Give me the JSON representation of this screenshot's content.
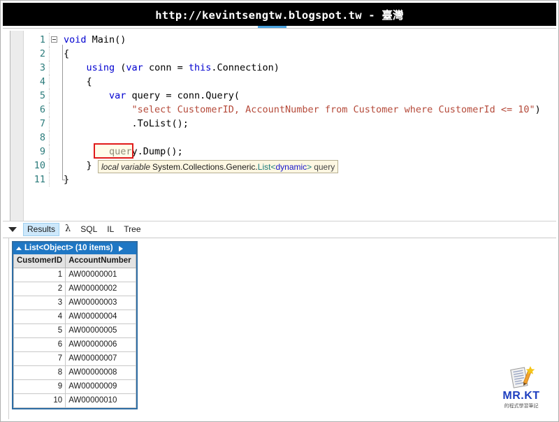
{
  "window": {
    "title_url": "http://kevintsengtw.blogspot.tw",
    "title_sep": " - ",
    "title_region": "臺灣"
  },
  "editor": {
    "lines": [
      {
        "n": "1",
        "indent": 0,
        "tokens": [
          {
            "t": "kw",
            "v": "void"
          },
          {
            "t": "plain",
            "v": " Main()"
          }
        ]
      },
      {
        "n": "2",
        "indent": 0,
        "tokens": [
          {
            "t": "plain",
            "v": "{"
          }
        ]
      },
      {
        "n": "3",
        "indent": 1,
        "tokens": [
          {
            "t": "kw",
            "v": "using"
          },
          {
            "t": "plain",
            "v": " ("
          },
          {
            "t": "kw",
            "v": "var"
          },
          {
            "t": "plain",
            "v": " conn = "
          },
          {
            "t": "kw",
            "v": "this"
          },
          {
            "t": "plain",
            "v": ".Connection)"
          }
        ]
      },
      {
        "n": "4",
        "indent": 1,
        "tokens": [
          {
            "t": "plain",
            "v": "{"
          }
        ]
      },
      {
        "n": "5",
        "indent": 2,
        "tokens": [
          {
            "t": "kw",
            "v": "var"
          },
          {
            "t": "plain",
            "v": " query = conn.Query("
          }
        ]
      },
      {
        "n": "6",
        "indent": 3,
        "tokens": [
          {
            "t": "str",
            "v": "\"select CustomerID, AccountNumber from Customer where CustomerId <= 10\""
          },
          {
            "t": "plain",
            "v": ")"
          }
        ]
      },
      {
        "n": "7",
        "indent": 3,
        "tokens": [
          {
            "t": "plain",
            "v": ".ToList();"
          }
        ]
      },
      {
        "n": "8",
        "indent": 0,
        "tokens": [
          {
            "t": "plain",
            "v": ""
          }
        ]
      },
      {
        "n": "9",
        "indent": 2,
        "tokens": [
          {
            "t": "plain",
            "v": "query.Dump();"
          }
        ]
      },
      {
        "n": "10",
        "indent": 1,
        "tokens": [
          {
            "t": "plain",
            "v": "}"
          }
        ]
      },
      {
        "n": "11",
        "indent": 0,
        "tokens": [
          {
            "t": "plain",
            "v": "}"
          }
        ]
      }
    ],
    "fold_marker": "collapse-box"
  },
  "tooltip": {
    "kind": "local variable",
    "type_prefix": "System.Collections.Generic.",
    "type_generic": "List",
    "open_angle": "<",
    "type_arg": "dynamic",
    "close_angle": ">",
    "symbol": "query"
  },
  "result_tabs": {
    "toggle_icon": "caret-down-icon",
    "items": [
      {
        "label": "Results",
        "active": true
      },
      {
        "label": "λ",
        "active": false
      },
      {
        "label": "SQL",
        "active": false
      },
      {
        "label": "IL",
        "active": false
      },
      {
        "label": "Tree",
        "active": false
      }
    ]
  },
  "grid": {
    "header_label": "List<Object> (10 items)",
    "collapse_icon": "triangle-up-icon",
    "expand_icon": "triangle-right-icon",
    "columns": [
      "CustomerID",
      "AccountNumber"
    ],
    "rows": [
      [
        "1",
        "AW00000001"
      ],
      [
        "2",
        "AW00000002"
      ],
      [
        "3",
        "AW00000003"
      ],
      [
        "4",
        "AW00000004"
      ],
      [
        "5",
        "AW00000005"
      ],
      [
        "6",
        "AW00000006"
      ],
      [
        "7",
        "AW00000007"
      ],
      [
        "8",
        "AW00000008"
      ],
      [
        "9",
        "AW00000009"
      ],
      [
        "10",
        "AW00000010"
      ]
    ]
  },
  "watermark": {
    "brand": "MR.KT",
    "subtitle": "的程式學習筆記"
  },
  "colors": {
    "banner_bg": "#000000",
    "banner_fg": "#ffffff",
    "keyword": "#0000d0",
    "string": "#b54a3a",
    "lineno": "#2b7b7b",
    "grid_header_bg": "#1f77c4",
    "tab_active_bg": "#cde8fb",
    "highlight_border": "#e01b1b",
    "tooltip_bg": "#fdf7e2",
    "brand": "#1f3fbf"
  }
}
